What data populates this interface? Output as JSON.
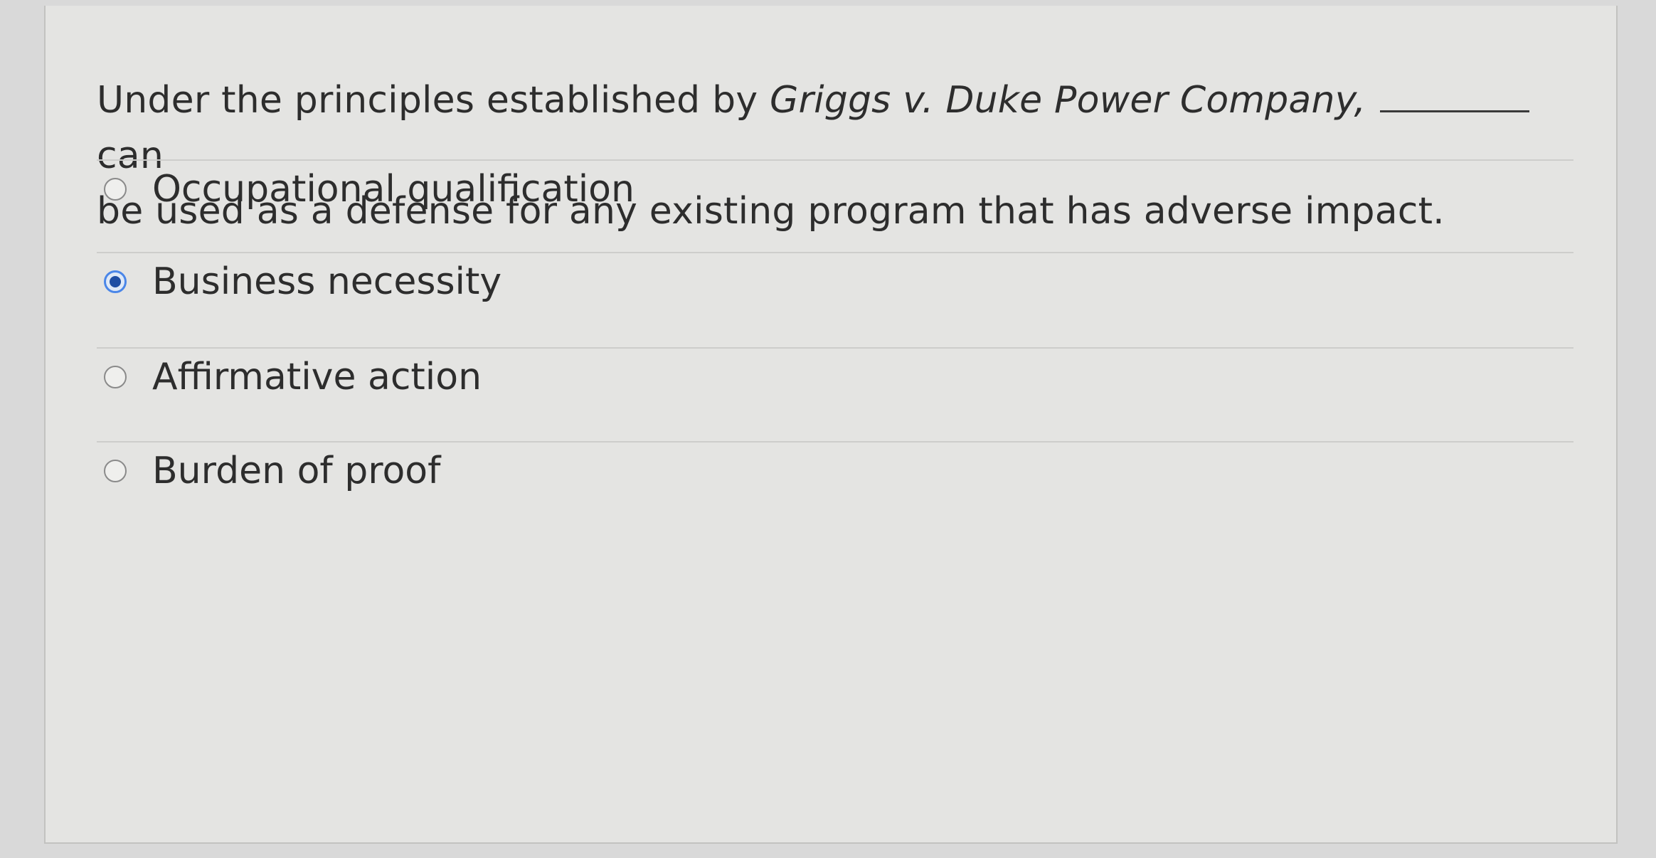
{
  "question": {
    "line1_before": "Under the principles established by ",
    "case_name": "Griggs v. Duke Power Company,",
    "line1_after": "can",
    "line2": "be used as a defense for any existing program that has adverse impact."
  },
  "options": [
    {
      "label": "Occupational qualification",
      "selected": false
    },
    {
      "label": "Business necessity",
      "selected": true
    },
    {
      "label": "Affirmative action",
      "selected": false
    },
    {
      "label": "Burden of proof",
      "selected": false
    }
  ],
  "colors": {
    "selected_radio": "#1f4ea3",
    "selected_ring": "#4a86e8"
  }
}
